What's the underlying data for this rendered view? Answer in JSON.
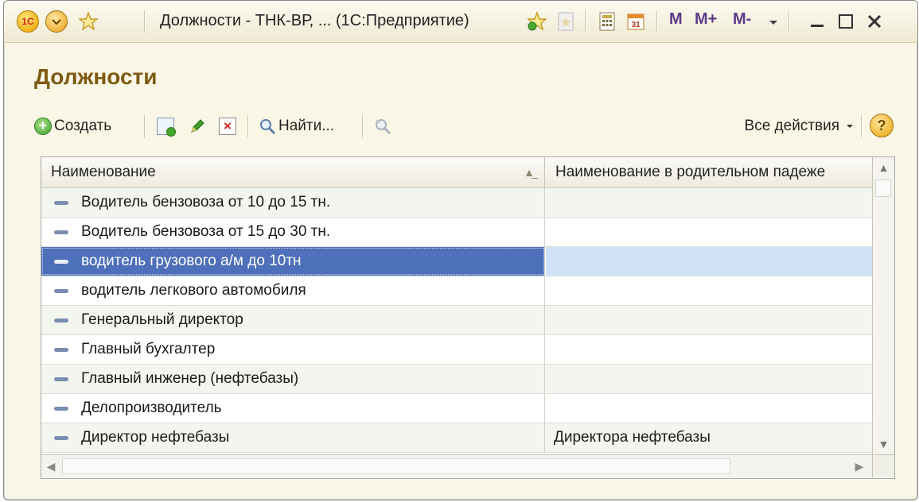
{
  "window": {
    "title": "Должности - ТНК-ВР, ... (1С:Предприятие)",
    "logo_text": "1С",
    "memory_buttons": [
      "M",
      "M+",
      "M-"
    ]
  },
  "page": {
    "title": "Должности"
  },
  "toolbar": {
    "create_label": "Создать",
    "find_label": "Найти...",
    "all_actions_label": "Все действия",
    "help_label": "?"
  },
  "table": {
    "columns": [
      "Наименование",
      "Наименование в родительном падеже"
    ],
    "rows": [
      {
        "name": "Водитель бензовоза от 10 до 15 тн.",
        "genitive": ""
      },
      {
        "name": "Водитель бензовоза от 15 до 30 тн.",
        "genitive": ""
      },
      {
        "name": "водитель грузового а/м до 10тн",
        "genitive": "",
        "selected": true
      },
      {
        "name": "водитель легкового автомобиля",
        "genitive": ""
      },
      {
        "name": "Генеральный директор",
        "genitive": ""
      },
      {
        "name": "Главный бухгалтер",
        "genitive": ""
      },
      {
        "name": "Главный инженер (нефтебазы)",
        "genitive": ""
      },
      {
        "name": "Делопроизводитель",
        "genitive": ""
      },
      {
        "name": "Директор нефтебазы",
        "genitive": "Директора нефтебазы"
      }
    ]
  },
  "colors": {
    "title_color": "#7d5a12",
    "selection": "#4e6fb9",
    "selection_light": "#cfe2f7",
    "window_bg": "#fbf7e6"
  }
}
